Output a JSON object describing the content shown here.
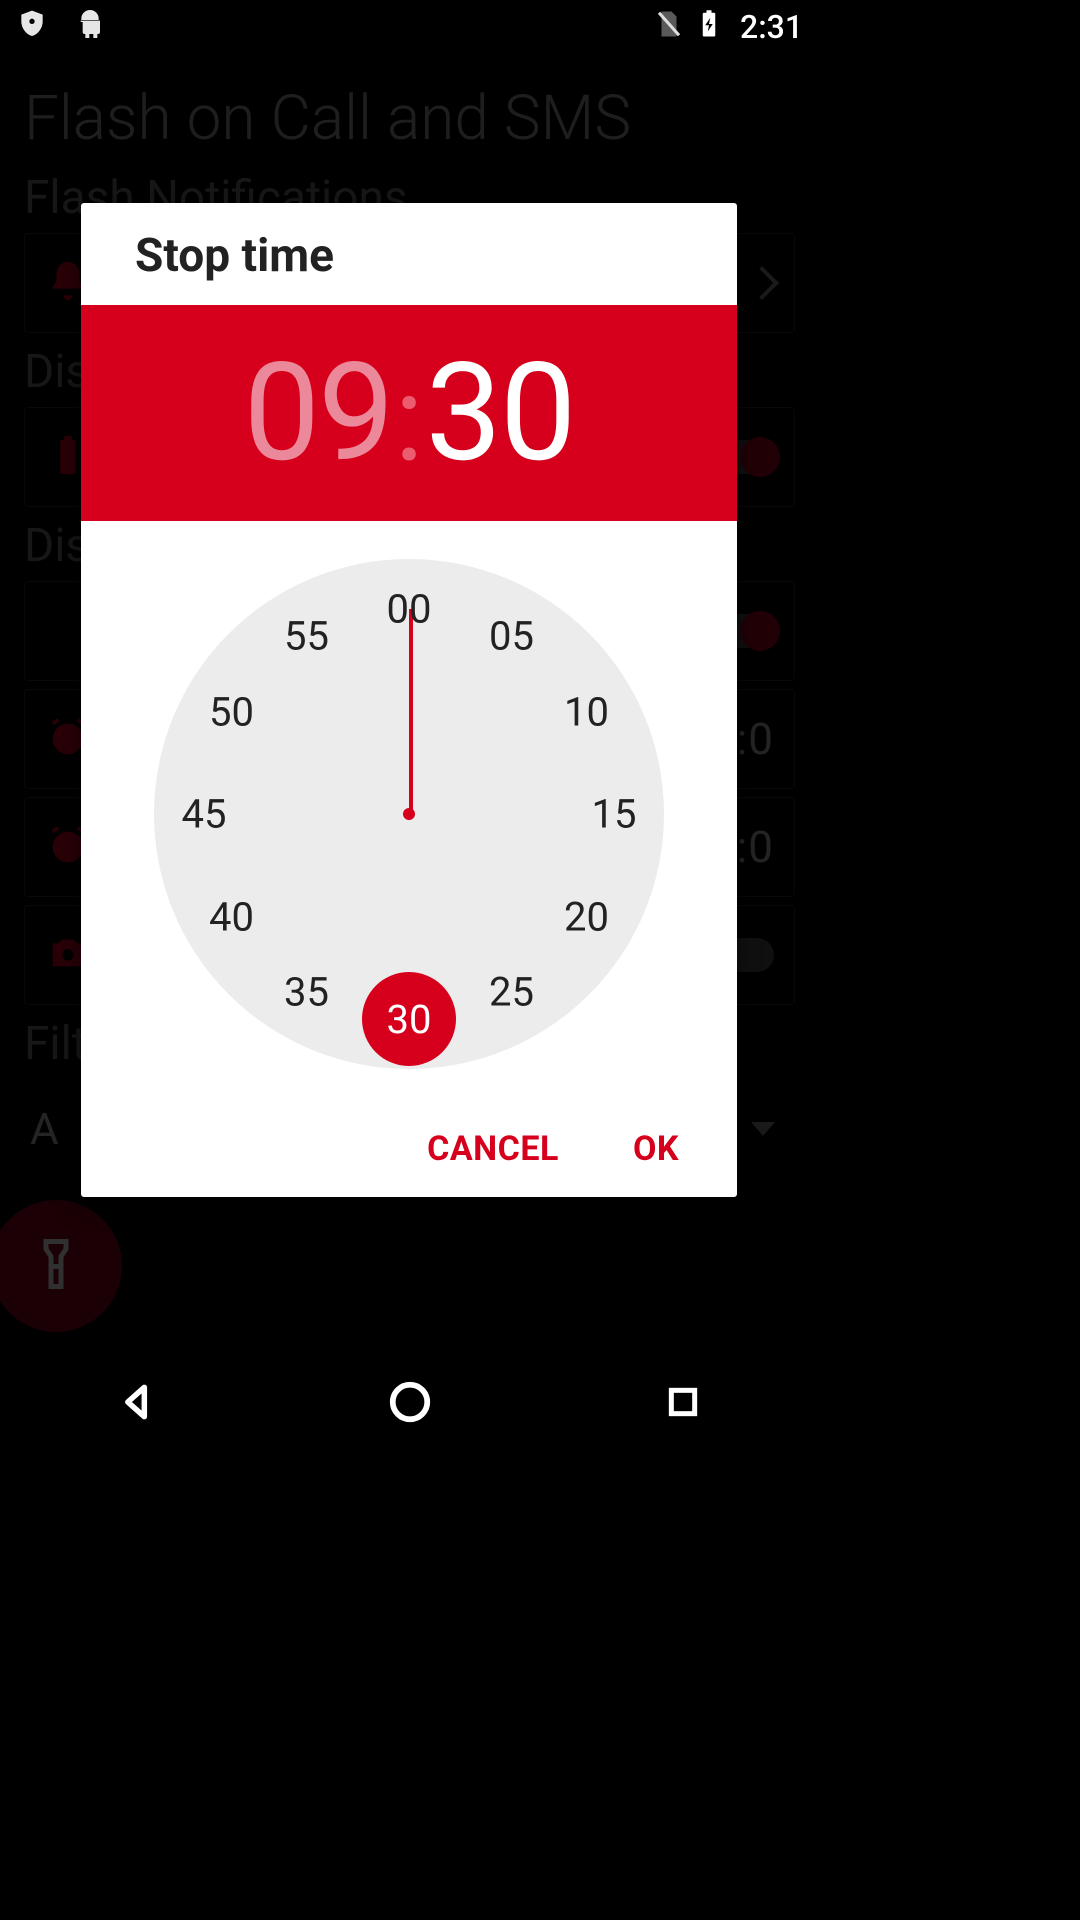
{
  "status_bar": {
    "time": "2:31"
  },
  "background": {
    "title": "Flash on Call and SMS",
    "section1": "Flash Notifications",
    "section_dis1": "Dis",
    "section_dis2": "Dis",
    "section_filter": "Filt",
    "row_a": "A",
    "time_a": ":0",
    "time_b": ":0"
  },
  "dialog": {
    "title": "Stop time",
    "hour": "09",
    "minute": "30",
    "active_part": "minute",
    "selected_minute": 30,
    "cancel_label": "CANCEL",
    "ok_label": "OK",
    "minute_ticks": [
      "00",
      "05",
      "10",
      "15",
      "20",
      "25",
      "30",
      "35",
      "40",
      "45",
      "50",
      "55"
    ],
    "accent_color": "#d6001c"
  }
}
